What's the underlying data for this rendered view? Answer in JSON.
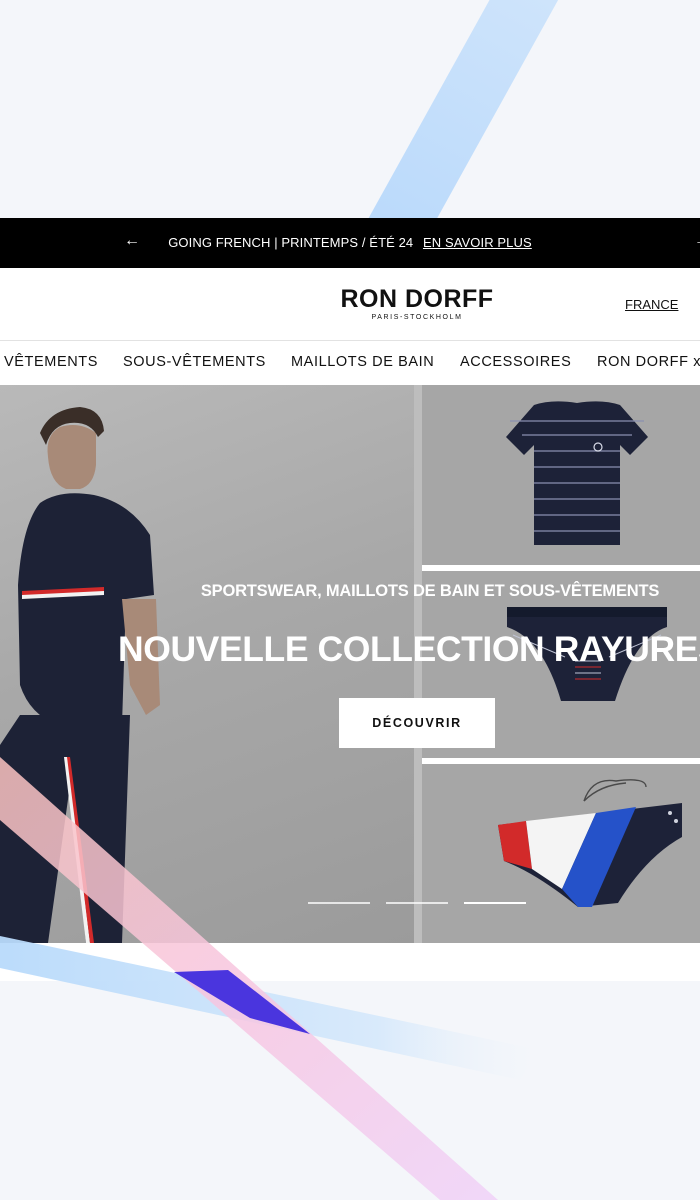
{
  "announcement": {
    "message": "GOING FRENCH | PRINTEMPS / ÉTÉ 24",
    "link": "EN SAVOIR PLUS",
    "prev_icon": "arrow-left-icon",
    "next_icon": "arrow-right-icon"
  },
  "header": {
    "logo_name": "RON DORFF",
    "logo_tagline": "PARIS-STOCKHOLM",
    "region": "FRANCE"
  },
  "nav": {
    "items": [
      "VÊTEMENTS",
      "SOUS-VÊTEMENTS",
      "MAILLOTS DE BAIN",
      "ACCESSOIRES",
      "RON DORFF x"
    ]
  },
  "hero": {
    "subtitle": "SPORTSWEAR, MAILLOTS DE BAIN ET SOUS-VÊTEMENTS",
    "title": "NOUVELLE COLLECTION RAYURES",
    "cta": "DÉCOUVRIR",
    "slides_total": 3,
    "active_slide": 3
  },
  "colors": {
    "announcement_bg": "#000000",
    "navy": "#1d2236",
    "french_blue": "#2552c9",
    "french_red": "#d22a2a"
  }
}
